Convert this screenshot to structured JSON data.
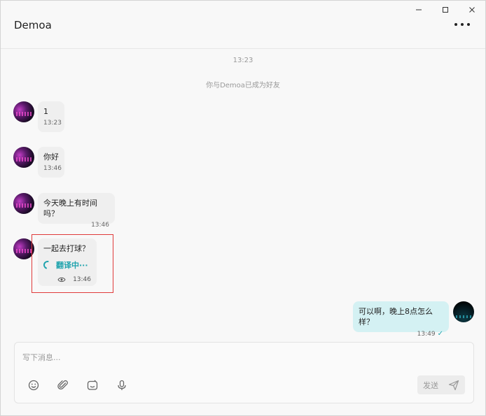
{
  "window": {
    "controls": {
      "minimize": "–",
      "maximize": "□",
      "close": "×"
    }
  },
  "header": {
    "title": "Demoa",
    "more_icon": "more-horizontal-icon"
  },
  "chat": {
    "timestamp": "13:23",
    "system_note": "你与Demoa已成为好友",
    "messages": [
      {
        "direction": "in",
        "text": "1",
        "time": "13:23"
      },
      {
        "direction": "in",
        "text": "你好",
        "time": "13:46"
      },
      {
        "direction": "in",
        "text": "今天晚上有时间吗？",
        "time": "13:46"
      },
      {
        "direction": "in",
        "text": "一起去打球？",
        "time": "13:46",
        "translating_label": "翻译中···"
      },
      {
        "direction": "out",
        "text": "可以啊，晚上8点怎么样？",
        "time": "13:49"
      }
    ],
    "colors": {
      "in_bubble": "#efefef",
      "out_bubble": "#d4f1f3",
      "accent": "#1fa3ad",
      "highlight": "#e03a3a"
    }
  },
  "composer": {
    "placeholder": "写下消息...",
    "send_label": "发送",
    "tools": [
      "emoji-icon",
      "attachment-icon",
      "sticker-icon",
      "microphone-icon"
    ]
  }
}
